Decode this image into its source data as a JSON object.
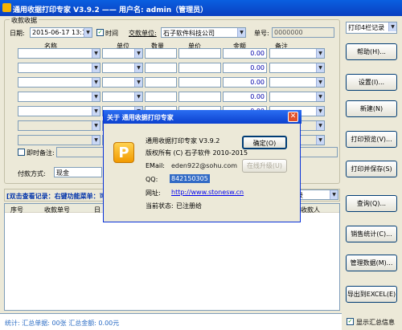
{
  "window": {
    "title": "通用收据打印专家 V3.9.2 —— 用户名: admin（管理员）"
  },
  "receipt": {
    "group_label": "收款收据",
    "date_label": "日期:",
    "date_value": "2015-06-17 13:17",
    "time_label": "时间",
    "payer_label": "交款单位:",
    "payer_value": "石子软件科技公司",
    "number_label": "单号:",
    "number_value": "0000000",
    "columns": [
      "名称",
      "单位",
      "数量",
      "单价",
      "金额",
      "备注"
    ],
    "rows": [
      {
        "amount": "0.00"
      },
      {
        "amount": "0.00"
      },
      {
        "amount": "0.00"
      },
      {
        "amount": "0.00"
      },
      {
        "amount": "0.00"
      },
      {
        "amount": ""
      },
      {
        "amount": ""
      }
    ],
    "instant_remark_label": "即时备注:",
    "payment_label": "付款方式:",
    "payment_value": "现金"
  },
  "query_bar": {
    "hint": "[双击查看记录：右键功能菜单：可",
    "select_suffix": "录"
  },
  "list": {
    "columns": [
      "序号",
      "收款单号",
      "日",
      "收款人"
    ]
  },
  "footer": {
    "summary": "统计:  汇总单据: 00张    汇总金额: 0.00元"
  },
  "right_panel": {
    "print_mode": "打印4栏记录",
    "buttons": [
      "帮助(H)...",
      "设置(I)...",
      "新建(N)",
      "打印预览(V)...",
      "打印并保存(S)",
      "查询(Q)...",
      "销售统计(C)...",
      "管理数据(M)...",
      "导出到EXCEL(E)"
    ],
    "show_summary_label": "显示汇总信息"
  },
  "about": {
    "title": "关于 通用收据打印专家",
    "logo_letter": "P",
    "product": "通用收据打印专家 V3.9.2",
    "copyright": "版权所有 (C) 石子软件 2010-2015",
    "email_label": "EMail:",
    "email": "eden922@sohu.com",
    "qq_label": "QQ:",
    "qq": "842150305",
    "url_label": "网址:",
    "url": "http://www.stonesw.cn",
    "status_label": "当前状态:",
    "status": "已注册给",
    "ok_button": "确定(O)",
    "upgrade_button": "在线升级(U)"
  }
}
